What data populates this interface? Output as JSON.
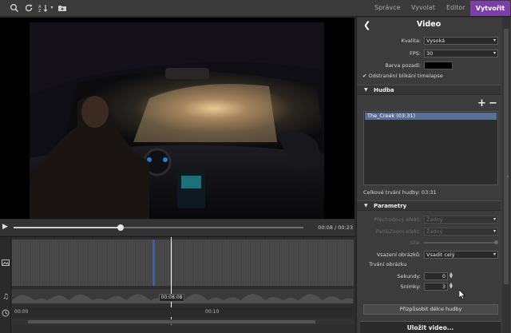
{
  "toolbar": {
    "icons": [
      "search-icon",
      "refresh-icon",
      "sort-icon",
      "chevron-down-icon",
      "add-folder-icon"
    ],
    "tabs": [
      "Správce",
      "Vyvolat",
      "Editor"
    ],
    "active_tab": "Vytvořit"
  },
  "player": {
    "time": "00:08 / 00:23",
    "progress": 0.37
  },
  "timeline": {
    "playhead_time": "00:08:08",
    "ruler_labels": [
      "00:00",
      "00:10"
    ]
  },
  "panel": {
    "title": "Video",
    "quality_label": "Kvalita:",
    "quality_value": "Vysoká",
    "fps_label": "FPS:",
    "fps_value": "30",
    "bg_label": "Barva pozadí:",
    "bg_color": "#000000",
    "flicker_label": "Odstranění blikání timelapse",
    "flicker_checked": true,
    "music": {
      "header": "Hudba",
      "tracks": [
        "The_Creek (03:31)"
      ],
      "total_label": "Celkové trvání hudby: 03:31"
    },
    "params": {
      "header": "Parametry",
      "transition_label": "Přechodový efekt:",
      "transition_value": "Žádný",
      "panzoom_label": "Pan&Zoom efekt:",
      "panzoom_value": "Žádný",
      "strength_label": "Síla:",
      "fit_label": "Vsazení obrázků:",
      "fit_value": "Vsadit celý",
      "duration_label": "Trvání obrázku",
      "seconds_label": "Sekundy:",
      "seconds_value": "0",
      "frames_label": "Snímky:",
      "frames_value": "3",
      "fit_music_button": "Přizpůsobit délce hudby"
    },
    "save_button": "Uložit video..."
  }
}
